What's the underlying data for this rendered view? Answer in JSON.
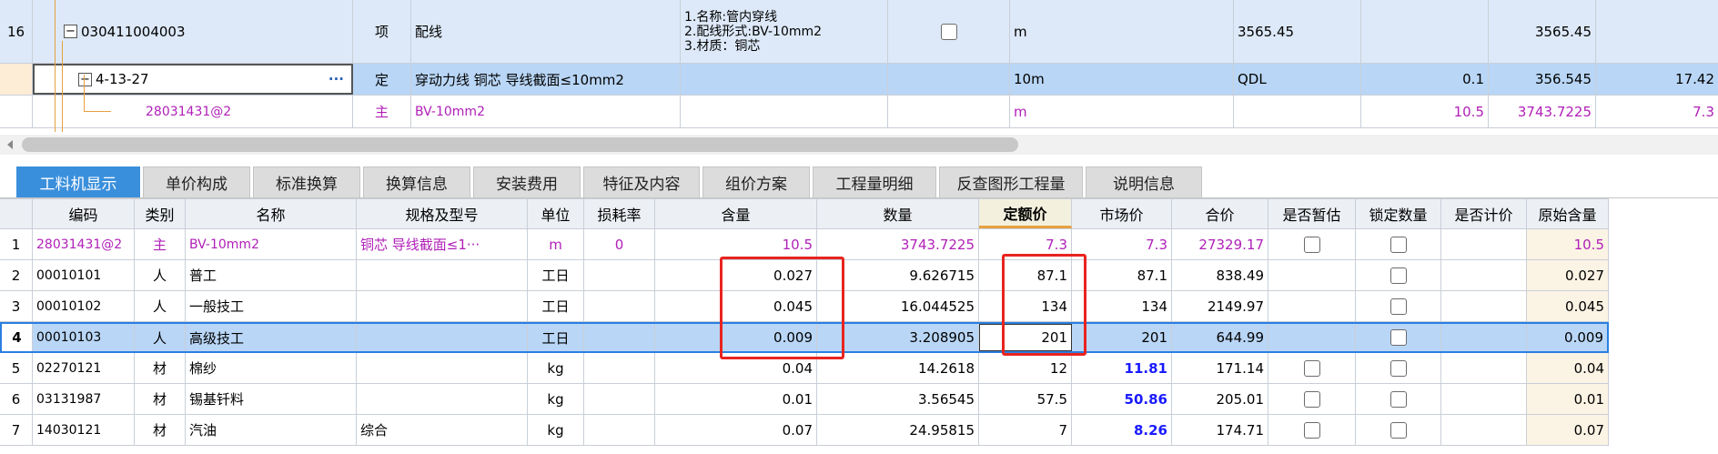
{
  "top_grid": {
    "rows": [
      {
        "no": "16",
        "code": "030411004003",
        "type": "项",
        "name": "配线",
        "spec_lines": [
          "1.名称:管内穿线",
          "2.配线形式:BV-10mm2",
          "3.材质：铜芯"
        ],
        "unit": "m",
        "expr": "3565.45",
        "content": "",
        "qty": "3565.45",
        "price": ""
      },
      {
        "no": "",
        "code": "4-13-27",
        "type": "定",
        "name": "穿动力线 铜芯 导线截面≤10mm2",
        "spec_lines": [],
        "unit": "10m",
        "expr": "QDL",
        "content": "0.1",
        "qty": "356.545",
        "price": "17.42",
        "more": "···"
      },
      {
        "no": "",
        "code": "28031431@2",
        "type": "主",
        "name": "BV-10mm2",
        "spec_lines": [],
        "unit": "m",
        "expr": "",
        "content": "10.5",
        "qty": "3743.7225",
        "price": "7.3"
      }
    ]
  },
  "tabs": [
    "工料机显示",
    "单价构成",
    "标准换算",
    "换算信息",
    "安装费用",
    "特征及内容",
    "组价方案",
    "工程量明细",
    "反查图形工程量",
    "说明信息"
  ],
  "active_tab": 0,
  "grid": {
    "headers": [
      "编码",
      "类别",
      "名称",
      "规格及型号",
      "单位",
      "损耗率",
      "含量",
      "数量",
      "定额价",
      "市场价",
      "合价",
      "是否暂估",
      "锁定数量",
      "是否计价",
      "原始含量"
    ],
    "rows": [
      {
        "no": "1",
        "code": "28031431@2",
        "type": "主",
        "name": "BV-10mm2",
        "spec": "铜芯 导线截面≤1···",
        "unit": "m",
        "loss": "0",
        "content": "10.5",
        "qty": "3743.7225",
        "base": "7.3",
        "market": "7.3",
        "total": "27329.17",
        "orig": "10.5"
      },
      {
        "no": "2",
        "code": "00010101",
        "type": "人",
        "name": "普工",
        "spec": "",
        "unit": "工日",
        "loss": "",
        "content": "0.027",
        "qty": "9.626715",
        "base": "87.1",
        "market": "87.1",
        "total": "838.49",
        "orig": "0.027"
      },
      {
        "no": "3",
        "code": "00010102",
        "type": "人",
        "name": "一般技工",
        "spec": "",
        "unit": "工日",
        "loss": "",
        "content": "0.045",
        "qty": "16.044525",
        "base": "134",
        "market": "134",
        "total": "2149.97",
        "orig": "0.045"
      },
      {
        "no": "4",
        "code": "00010103",
        "type": "人",
        "name": "高级技工",
        "spec": "",
        "unit": "工日",
        "loss": "",
        "content": "0.009",
        "qty": "3.208905",
        "base": "201",
        "market": "201",
        "total": "644.99",
        "orig": "0.009"
      },
      {
        "no": "5",
        "code": "02270121",
        "type": "材",
        "name": "棉纱",
        "spec": "",
        "unit": "kg",
        "loss": "",
        "content": "0.04",
        "qty": "14.2618",
        "base": "12",
        "market": "11.81",
        "total": "171.14",
        "orig": "0.04"
      },
      {
        "no": "6",
        "code": "03131987",
        "type": "材",
        "name": "锡基钎料",
        "spec": "",
        "unit": "kg",
        "loss": "",
        "content": "0.01",
        "qty": "3.56545",
        "base": "57.5",
        "market": "50.86",
        "total": "205.01",
        "orig": "0.01"
      },
      {
        "no": "7",
        "code": "14030121",
        "type": "材",
        "name": "汽油",
        "spec": "综合",
        "unit": "kg",
        "loss": "",
        "content": "0.07",
        "qty": "24.95815",
        "base": "7",
        "market": "8.26",
        "total": "174.71",
        "orig": "0.07"
      }
    ]
  }
}
